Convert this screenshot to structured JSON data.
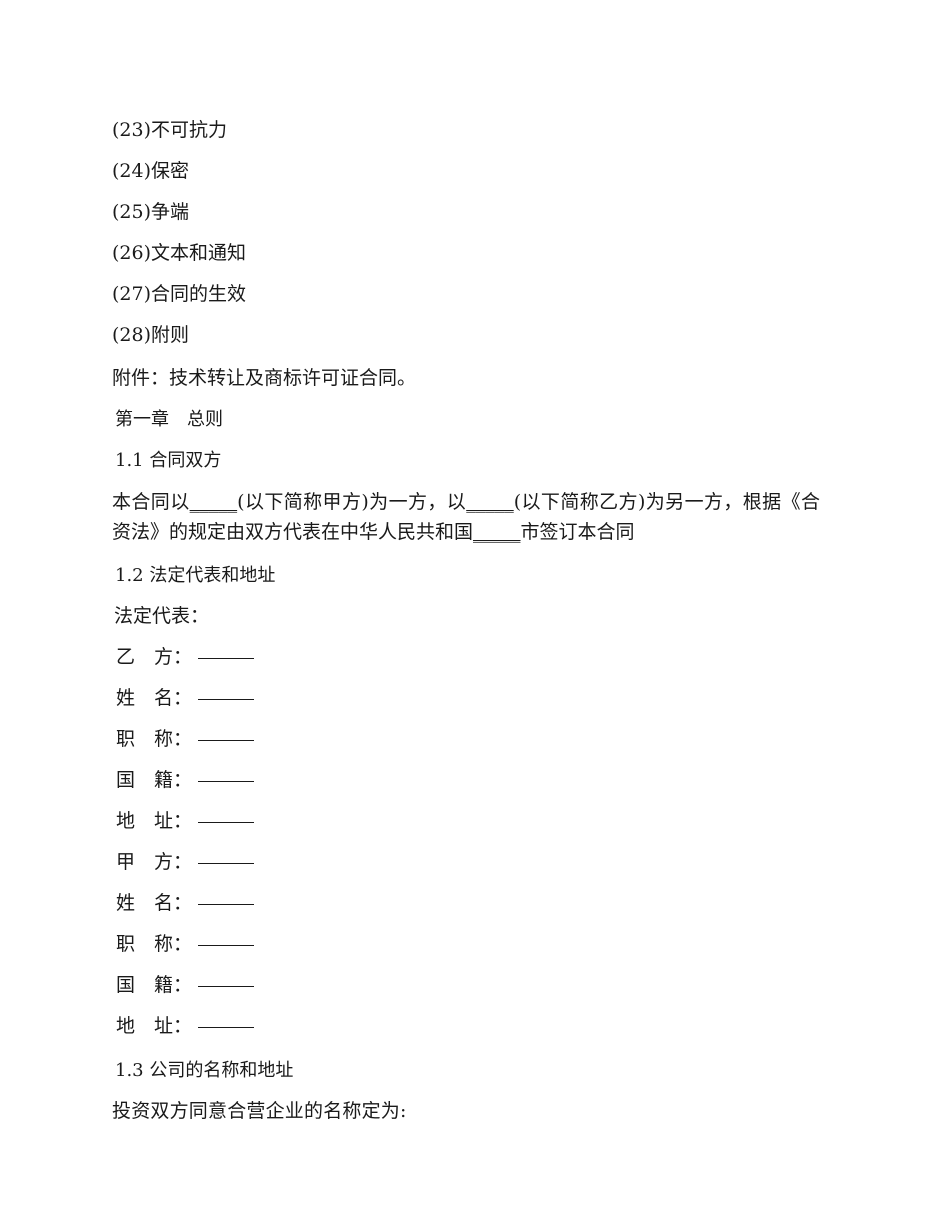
{
  "document": {
    "language": "zh-CN",
    "background_color": "#ffffff",
    "text_color": "#1a1a1a",
    "clause_list": [
      {
        "number": "(23)",
        "text": "不可抗力",
        "full": "(23)不可抗力"
      },
      {
        "number": "(24)",
        "text": "保密",
        "full": "(24)保密"
      },
      {
        "number": "(25)",
        "text": "争端",
        "full": "(25)争端"
      },
      {
        "number": "(26)",
        "text": "文本和通知",
        "full": "(26)文本和通知"
      },
      {
        "number": "(27)",
        "text": "合同的生效",
        "full": "(27)合同的生效"
      },
      {
        "number": "(28)",
        "text": "附则",
        "full": "(28)附则"
      }
    ],
    "attachment_line": "附件：技术转让及商标许可证合同。",
    "chapter_heading": "第一章　总则",
    "sections": [
      {
        "number": "1.1",
        "title": "合同双方",
        "full": "1.1 合同双方"
      },
      {
        "number": "1.2",
        "title": "法定代表和地址",
        "full": "1.2 法定代表和地址"
      },
      {
        "number": "1.3",
        "title": "公司的名称和地址",
        "full": "1.3 公司的名称和地址"
      }
    ],
    "parties_paragraph": {
      "part1": "本合同以",
      "blank1": "_____",
      "part2": "(以下简称甲方)为一方，以",
      "blank2": "_____",
      "part3": "(以下简称乙方)为另一方，根据《合资法》的规定由双方代表在中华人民共和国",
      "blank3": "_____",
      "part4": "市签订本合同"
    },
    "legal_rep_label": "法定代表：",
    "party_b_fields": [
      {
        "label": "乙　方：",
        "value": "_____"
      },
      {
        "label": "姓　名：",
        "value": "_____"
      },
      {
        "label": "职　称：",
        "value": "_____"
      },
      {
        "label": "国　籍：",
        "value": "_____"
      },
      {
        "label": "地　址：",
        "value": "_____"
      }
    ],
    "party_a_fields": [
      {
        "label": "甲　方：",
        "value": "_____"
      },
      {
        "label": "姓　名：",
        "value": "_____"
      },
      {
        "label": "职　称：",
        "value": "_____"
      },
      {
        "label": "国　籍：",
        "value": "_____"
      },
      {
        "label": "地　址：",
        "value": "_____"
      }
    ],
    "company_name_line": "投资双方同意合营企业的名称定为:"
  }
}
